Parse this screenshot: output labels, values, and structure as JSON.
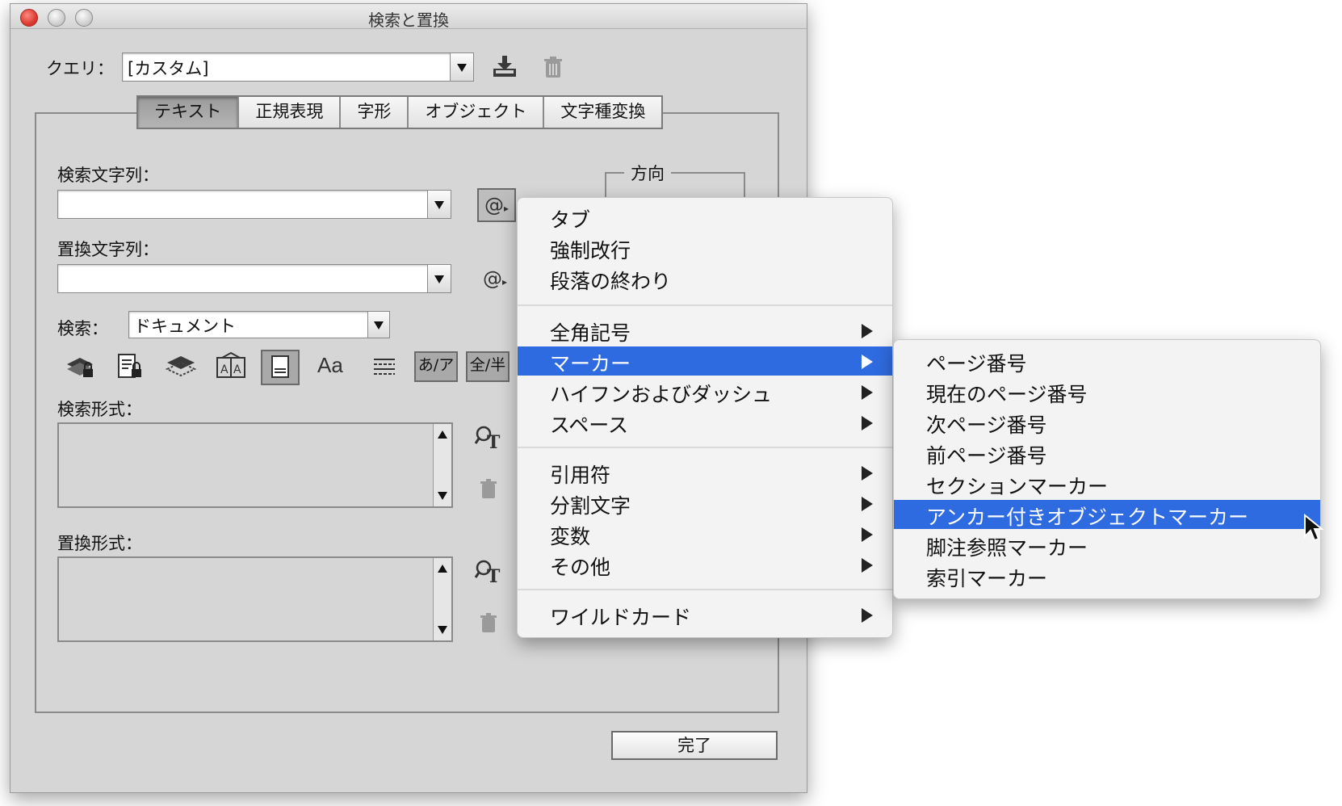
{
  "window": {
    "title": "検索と置換"
  },
  "query": {
    "label": "クエリ：",
    "value": "[カスタム]"
  },
  "tabs": [
    "テキスト",
    "正規表現",
    "字形",
    "オブジェクト",
    "文字種変換"
  ],
  "find": {
    "label": "検索文字列：",
    "value": "",
    "special_char_icon": "@"
  },
  "replace": {
    "label": "置換文字列：",
    "value": "",
    "special_char_icon": "@"
  },
  "direction": {
    "label": "方向"
  },
  "search_scope": {
    "label": "検索：",
    "value": "ドキュメント"
  },
  "options": {
    "case_label": "Aa",
    "kana_label": "あ/ア",
    "width_label": "全/半"
  },
  "find_format": {
    "label": "検索形式："
  },
  "replace_format": {
    "label": "置換形式："
  },
  "done_button": "完了",
  "special_menu": {
    "group1": [
      "タブ",
      "強制改行",
      "段落の終わり"
    ],
    "group2": [
      "全角記号",
      "マーカー",
      "ハイフンおよびダッシュ",
      "スペース"
    ],
    "group3": [
      "引用符",
      "分割文字",
      "変数",
      "その他"
    ],
    "group4": [
      "ワイルドカード"
    ],
    "highlighted": "マーカー"
  },
  "marker_submenu": {
    "items": [
      "ページ番号",
      "現在のページ番号",
      "次ページ番号",
      "前ページ番号",
      "セクションマーカー",
      "アンカー付きオブジェクトマーカー",
      "脚注参照マーカー",
      "索引マーカー"
    ],
    "highlighted": "アンカー付きオブジェクトマーカー"
  },
  "colors": {
    "highlight": "#2f6be0",
    "dialog_bg": "#d6d6d6",
    "menu_bg": "#f3f3f3"
  }
}
